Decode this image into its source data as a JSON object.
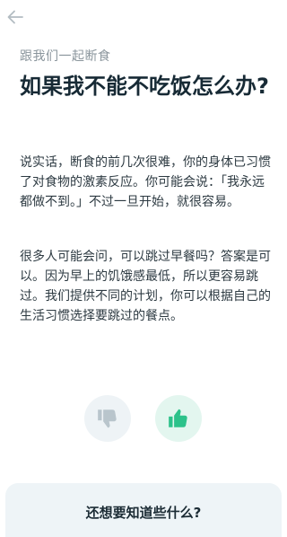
{
  "header": {
    "back_icon": "arrow-left-icon"
  },
  "article": {
    "eyebrow": "跟我们一起断食",
    "title": "如果我不能不吃饭怎么办?",
    "paragraphs": [
      "说实话，断食的前几次很难，你的身体已习惯了对食物的激素反应。你可能会说：「我永远都做不到。」不过一旦开始，就很容易。",
      "很多人可能会问，可以跳过早餐吗？答案是可以。因为早上的饥饿感最低，所以更容易跳过。我们提供不同的计划，你可以根据自己的生活习惯选择要跳过的餐点。"
    ]
  },
  "feedback": {
    "dislike_icon": "thumbs-down-icon",
    "like_icon": "thumbs-up-icon",
    "dislike_color": "#b9c5cc",
    "like_color": "#2cc28a"
  },
  "more": {
    "title": "还想要知道些什么?"
  }
}
